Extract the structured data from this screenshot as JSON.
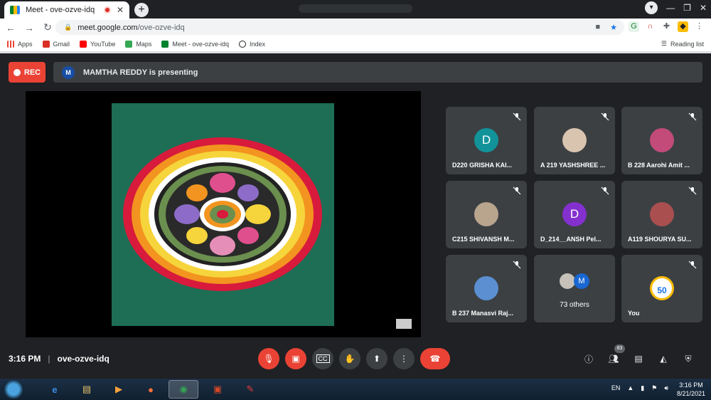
{
  "browser": {
    "tab_title": "Meet - ove-ozve-idq",
    "url_host": "meet.google.com",
    "url_path": "/ove-ozve-idq",
    "new_tab": "+",
    "bookmarks": [
      {
        "label": "Apps",
        "color": "#ea4335"
      },
      {
        "label": "Gmail",
        "color": "#d93025"
      },
      {
        "label": "YouTube",
        "color": "#ff0000"
      },
      {
        "label": "Maps",
        "color": "#34a853"
      },
      {
        "label": "Meet - ove-ozve-idq",
        "color": "#00832d"
      },
      {
        "label": "Index",
        "color": "#202124"
      }
    ],
    "reading_list": "Reading list"
  },
  "meet": {
    "rec_label": "REC",
    "presenter_initial": "M",
    "presenting_text": "MAMTHA REDDY is presenting",
    "participants": [
      {
        "name": "D220 GRISHA KAI...",
        "initial": "D",
        "avatar_color": "#12939a"
      },
      {
        "name": "A 219 YASHSHREE ...",
        "initial": "",
        "avatar_color": "#d9c4b0"
      },
      {
        "name": "B 228 Aarohi Amit ...",
        "initial": "",
        "avatar_color": "#c24b7a"
      },
      {
        "name": "C215 SHIVANSH M...",
        "initial": "",
        "avatar_color": "#b9a48e"
      },
      {
        "name": "D_214__ANSH Pel...",
        "initial": "D",
        "avatar_color": "#8430ce"
      },
      {
        "name": "A119 SHOURYA SU...",
        "initial": "",
        "avatar_color": "#a94f4f"
      },
      {
        "name": "B 237 Manasvi Raj...",
        "initial": "",
        "avatar_color": "#5b8fd1"
      },
      {
        "name": "73 others",
        "initial": "M",
        "avatar_color": "#1967d2"
      },
      {
        "name": "You",
        "initial": "50",
        "avatar_color": "#ffffff"
      }
    ],
    "time": "3:16 PM",
    "meeting_code": "ove-ozve-idq",
    "people_count": "83"
  },
  "taskbar": {
    "language": "EN",
    "clock_time": "3:16 PM",
    "clock_date": "8/21/2021"
  }
}
